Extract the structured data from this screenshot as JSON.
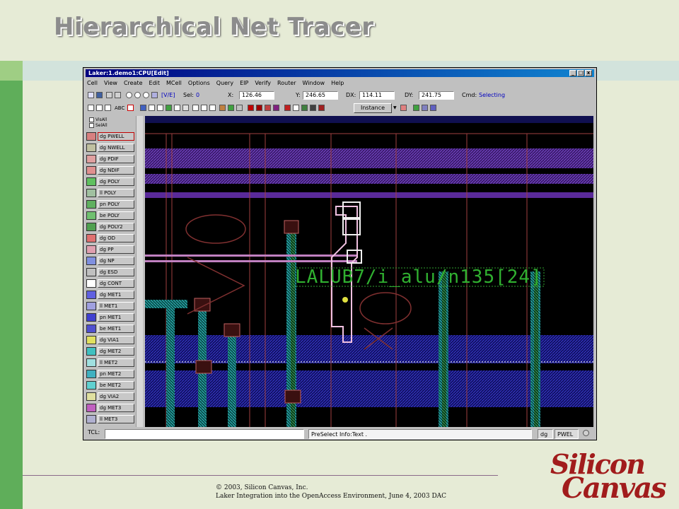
{
  "slide": {
    "title": "Hierarchical Net Tracer",
    "footer_line1": "© 2003, Silicon Canvas, Inc.",
    "footer_line2": "Laker Integration into the OpenAccess Environment, June 4, 2003 DAC",
    "logo_line1": "Silicon",
    "logo_line2": "Canvas"
  },
  "window": {
    "title": "Laker:1.demo1:CPU[Edit]",
    "min_symbol": "_",
    "max_symbol": "□",
    "close_symbol": "x"
  },
  "menu": [
    "Cell",
    "View",
    "Create",
    "Edit",
    "MCell",
    "Options",
    "Query",
    "EIP",
    "Verify",
    "Router",
    "Window",
    "Help"
  ],
  "toolbar": {
    "mode": "[V/E]",
    "sel_label": "Sel:",
    "sel_value": "0",
    "x_label": "X:",
    "x_value": "126.46",
    "y_label": "Y:",
    "y_value": "246.65",
    "dx_label": "DX:",
    "dx_value": "114.11",
    "dy_label": "DY:",
    "dy_value": "241.75",
    "cmd_label": "Cmd:",
    "cmd_value": "Selecting",
    "abc_label": "ABC",
    "instance_label": "Instance",
    "instance_arrow": "▼"
  },
  "layer_panel": {
    "visall": "VisAll",
    "selall": "SelAll",
    "layers": [
      {
        "purpose": "dg",
        "name": "PWELL",
        "color": "#d88080"
      },
      {
        "purpose": "dg",
        "name": "NWELL",
        "color": "#c0c0a0"
      },
      {
        "purpose": "dg",
        "name": "PDIF",
        "color": "#e0a0a0"
      },
      {
        "purpose": "dg",
        "name": "NDIF",
        "color": "#e09090"
      },
      {
        "purpose": "dg",
        "name": "POLY",
        "color": "#60c060"
      },
      {
        "purpose": "ll",
        "name": "POLY",
        "color": "#a0c0a0"
      },
      {
        "purpose": "pn",
        "name": "POLY",
        "color": "#60b060"
      },
      {
        "purpose": "be",
        "name": "POLY",
        "color": "#70c070"
      },
      {
        "purpose": "dg",
        "name": "POLY2",
        "color": "#50a050"
      },
      {
        "purpose": "dg",
        "name": "OD",
        "color": "#e07070"
      },
      {
        "purpose": "dg",
        "name": "PP",
        "color": "#e0a0b0"
      },
      {
        "purpose": "dg",
        "name": "NP",
        "color": "#8090e0"
      },
      {
        "purpose": "dg",
        "name": "ESD",
        "color": "#c0c0c0"
      },
      {
        "purpose": "dg",
        "name": "CONT",
        "color": "#ffffff"
      },
      {
        "purpose": "dg",
        "name": "MET1",
        "color": "#6060e0"
      },
      {
        "purpose": "ll",
        "name": "MET1",
        "color": "#a0a0e0"
      },
      {
        "purpose": "pn",
        "name": "MET1",
        "color": "#4040d0"
      },
      {
        "purpose": "be",
        "name": "MET1",
        "color": "#5050d0"
      },
      {
        "purpose": "dg",
        "name": "VIA1",
        "color": "#e0e060"
      },
      {
        "purpose": "dg",
        "name": "MET2",
        "color": "#40c0c0"
      },
      {
        "purpose": "ll",
        "name": "MET2",
        "color": "#a0e0e0"
      },
      {
        "purpose": "pn",
        "name": "MET2",
        "color": "#40b0c0"
      },
      {
        "purpose": "be",
        "name": "MET2",
        "color": "#60d0d0"
      },
      {
        "purpose": "dg",
        "name": "VIA2",
        "color": "#e0e0a0"
      },
      {
        "purpose": "dg",
        "name": "MET3",
        "color": "#c060c0"
      },
      {
        "purpose": "ll",
        "name": "MET3",
        "color": "#b0b0d0"
      }
    ]
  },
  "canvas": {
    "net_label": "LALUB7/i_alu/n135[24]"
  },
  "status": {
    "tcl_label": "TCL:",
    "preselect": "PreSelect Info:Text .",
    "layer_purpose": "dg",
    "layer_name": "PWEL"
  }
}
